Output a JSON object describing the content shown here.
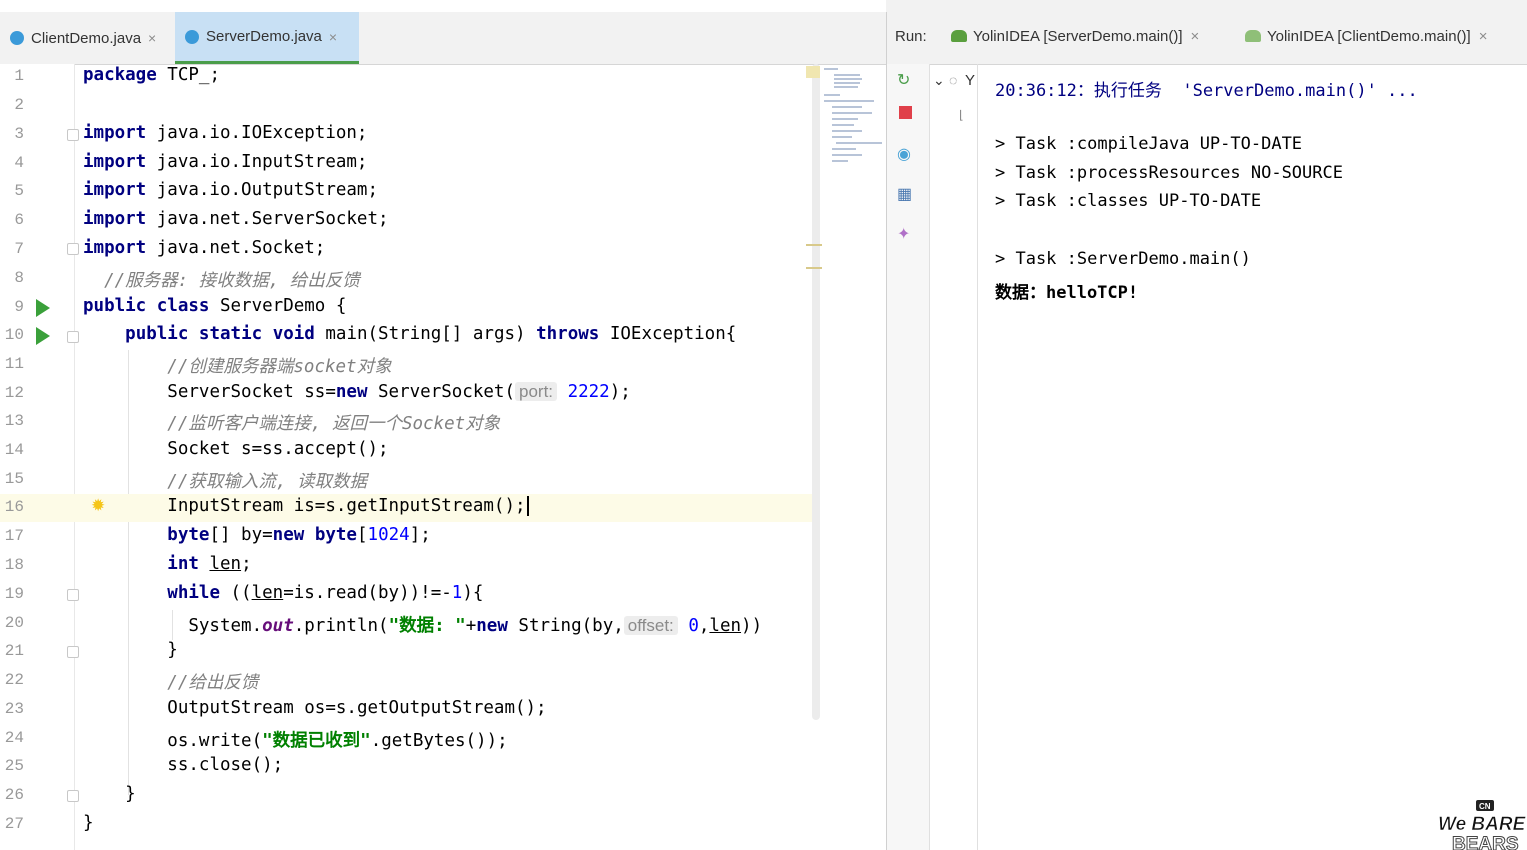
{
  "tabs": [
    {
      "label": "ClientDemo.java",
      "active": false
    },
    {
      "label": "ServerDemo.java",
      "active": true
    }
  ],
  "close_glyph": "×",
  "line_numbers": [
    "1",
    "2",
    "3",
    "4",
    "5",
    "6",
    "7",
    "8",
    "9",
    "10",
    "11",
    "12",
    "13",
    "14",
    "15",
    "16",
    "17",
    "18",
    "19",
    "20",
    "21",
    "22",
    "23",
    "24",
    "25",
    "26",
    "27"
  ],
  "code": {
    "l1": {
      "kw": "package",
      "rest": " TCP_;"
    },
    "l3": {
      "kw": "import",
      "rest": " java.io.IOException;"
    },
    "l4": {
      "kw": "import",
      "rest": " java.io.InputStream;"
    },
    "l5": {
      "kw": "import",
      "rest": " java.io.OutputStream;"
    },
    "l6": {
      "kw": "import",
      "rest": " java.net.ServerSocket;"
    },
    "l7": {
      "kw": "import",
      "rest": " java.net.Socket;"
    },
    "l8": {
      "comment": "  //服务器: 接收数据, 给出反馈"
    },
    "l9": {
      "kw1": "public",
      "kw2": "class",
      "rest": " ServerDemo {"
    },
    "l10": {
      "kw1": "public",
      "kw2": "static",
      "kw3": "void",
      "mid": " main(String[] args) ",
      "kw4": "throws",
      "rest": " IOException{"
    },
    "l11": {
      "comment": "//创建服务器端socket对象"
    },
    "l12": {
      "a": "ServerSocket ss=",
      "kw": "new",
      "b": " ServerSocket(",
      "hint": "port:",
      "num": "2222",
      "c": ");"
    },
    "l13": {
      "comment": "//监听客户端连接, 返回一个Socket对象"
    },
    "l14": {
      "text": "Socket s=ss.accept();"
    },
    "l15": {
      "comment": "//获取输入流, 读取数据"
    },
    "l16": {
      "text": "InputStream is=s.getInputStream();"
    },
    "l17": {
      "kw1": "byte",
      "a": "[] by=",
      "kw2": "new",
      "kw3": "byte",
      "b": "[",
      "num": "1024",
      "c": "];"
    },
    "l18": {
      "kw": "int",
      "sp": " ",
      "var": "len",
      "c": ";"
    },
    "l19": {
      "kw": "while",
      "a": " ((",
      "var": "len",
      "b": "=is.read(by))!=-",
      "num": "1",
      "c": "){"
    },
    "l20": {
      "a": "System.",
      "fld": "out",
      "b": ".println(",
      "str": "\"数据: \"",
      "c": "+",
      "kw": "new",
      "d": " String(by,",
      "hint": "offset:",
      "num": "0",
      "e": ",",
      "var": "len",
      "f": "))"
    },
    "l21": {
      "text": "}"
    },
    "l22": {
      "comment": "//给出反馈"
    },
    "l23": {
      "text": "OutputStream os=s.getOutputStream();"
    },
    "l24": {
      "a": "os.write(",
      "str": "\"数据已收到\"",
      "b": ".getBytes());"
    },
    "l25": {
      "text": "ss.close();"
    },
    "l26": {
      "text": "}"
    },
    "l27": {
      "text": "}"
    }
  },
  "run": {
    "label": "Run:",
    "tabs": [
      {
        "label": "YolinIDEA [ServerDemo.main()]"
      },
      {
        "label": "YolinIDEA [ClientDemo.main()]"
      }
    ],
    "tree_fragment": "Y"
  },
  "console": {
    "line1_time": "20:36:12：执行任务  'ServerDemo.main()' ...",
    "line3": "> Task :compileJava UP-TO-DATE",
    "line4": "> Task :processResources NO-SOURCE",
    "line5": "> Task :classes UP-TO-DATE",
    "line7": "> Task :ServerDemo.main()",
    "line8": "数据：helloTCP!"
  },
  "logo": {
    "top": "CN",
    "line1": "We BARE",
    "line2": "BEARS"
  },
  "colors": {
    "keyword": "#000080",
    "comment": "#808080",
    "string": "#008000",
    "number": "#0000ff",
    "run_green": "#3aa03a",
    "active_tab": "#c8e0f4"
  }
}
